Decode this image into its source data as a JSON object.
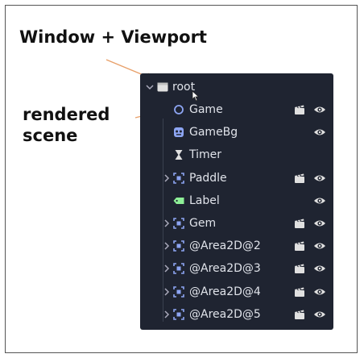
{
  "annotations": {
    "window_viewport": "Window + Viewport",
    "rendered_scene": "rendered\nscene"
  },
  "tree": {
    "root": {
      "label": "root",
      "icon": "node-icon"
    },
    "nodes": [
      {
        "label": "Game",
        "icon": "node2d-icon",
        "expandable": false,
        "clapper": true,
        "eye": true
      },
      {
        "label": "GameBg",
        "icon": "sprite-icon",
        "expandable": false,
        "clapper": false,
        "eye": true
      },
      {
        "label": "Timer",
        "icon": "timer-icon",
        "expandable": false,
        "clapper": false,
        "eye": false
      },
      {
        "label": "Paddle",
        "icon": "area2d-icon",
        "expandable": true,
        "clapper": true,
        "eye": true
      },
      {
        "label": "Label",
        "icon": "label-icon",
        "expandable": false,
        "clapper": false,
        "eye": true
      },
      {
        "label": "Gem",
        "icon": "area2d-icon",
        "expandable": true,
        "clapper": true,
        "eye": true
      },
      {
        "label": "@Area2D@2",
        "icon": "area2d-icon",
        "expandable": true,
        "clapper": true,
        "eye": true
      },
      {
        "label": "@Area2D@3",
        "icon": "area2d-icon",
        "expandable": true,
        "clapper": true,
        "eye": true
      },
      {
        "label": "@Area2D@4",
        "icon": "area2d-icon",
        "expandable": true,
        "clapper": true,
        "eye": true
      },
      {
        "label": "@Area2D@5",
        "icon": "area2d-icon",
        "expandable": true,
        "clapper": true,
        "eye": true
      }
    ]
  },
  "colors": {
    "panel_bg": "#1f2431",
    "text": "#e0e3ea",
    "node2d_blue": "#8da5f3",
    "label_green": "#8eef97",
    "arrow_orange": "#e8a06a",
    "icon_grey": "#e0e0e0"
  }
}
